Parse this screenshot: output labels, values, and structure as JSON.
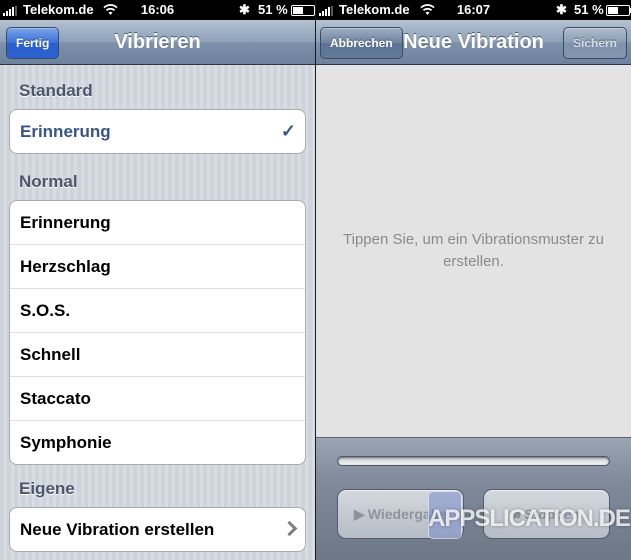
{
  "left": {
    "status": {
      "carrier": "Telekom.de",
      "time": "16:06",
      "battery": "51 %"
    },
    "nav": {
      "title": "Vibrieren",
      "done_label": "Fertig"
    },
    "sections": {
      "standard": {
        "header": "Standard",
        "items": [
          "Erinnerung"
        ],
        "selected": "Erinnerung"
      },
      "normal": {
        "header": "Normal",
        "items": [
          "Erinnerung",
          "Herzschlag",
          "S.O.S.",
          "Schnell",
          "Staccato",
          "Symphonie"
        ]
      },
      "eigene": {
        "header": "Eigene",
        "items": [
          "Neue Vibration erstellen"
        ]
      }
    },
    "icons": {
      "selected": "checkmark-icon",
      "disclosure": "chevron-right-icon"
    }
  },
  "right": {
    "status": {
      "carrier": "Telekom.de",
      "time": "16:07",
      "battery": "51 %"
    },
    "nav": {
      "title": "Neue Vibration",
      "cancel_label": "Abbrechen",
      "save_label": "Sichern"
    },
    "hint": "Tippen Sie, um ein Vibrationsmuster zu erstellen.",
    "toolbar": {
      "play_label": "Wiedergabe",
      "stop_label": "Stoppen",
      "play_icon": "play-icon",
      "stop_icon": "stop-icon"
    },
    "watermark": "APPSLICATION.DE"
  },
  "colors": {
    "accent_blue": "#385487",
    "nav_gradient": "#8ea1b9",
    "done_button": "#2a62d0"
  }
}
